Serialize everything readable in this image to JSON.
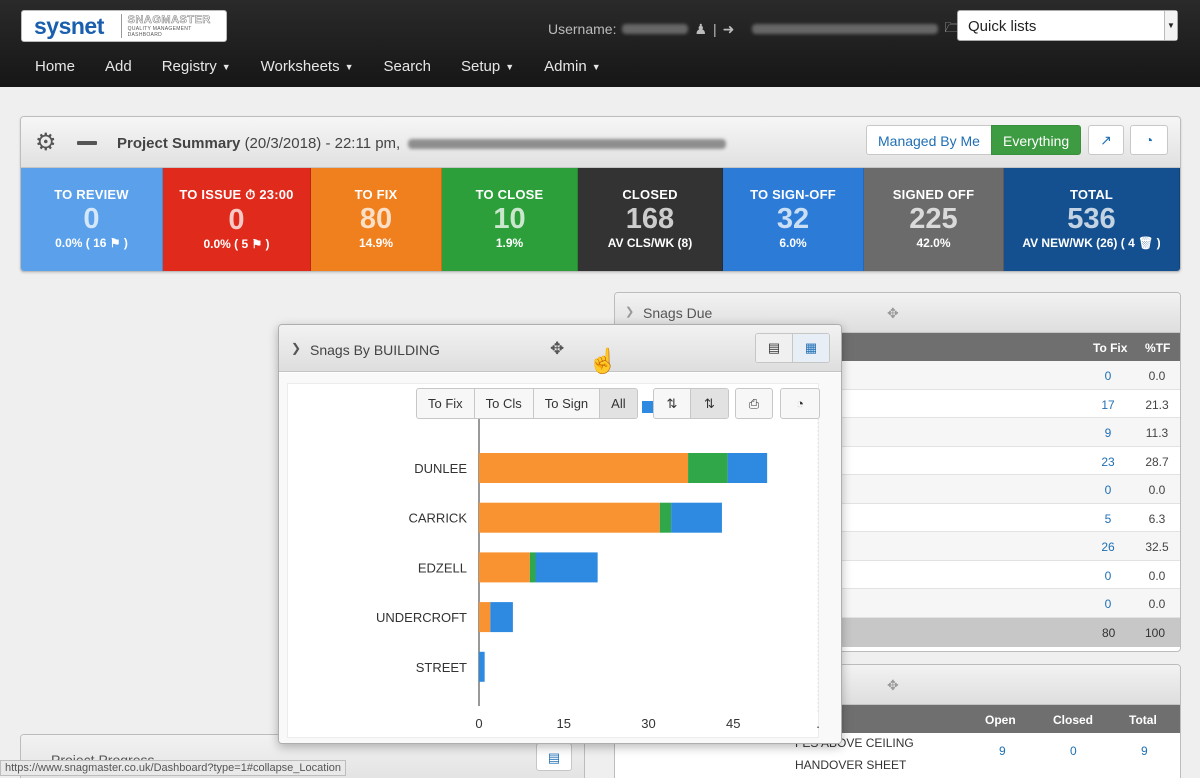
{
  "header": {
    "logo_main": "sysnet",
    "logo_sub": "SNAGMASTER",
    "logo_tagline": "QUALITY MANAGEMENT DASHBOARD",
    "username_label": "Username:",
    "separator": "|",
    "quick_lists": "Quick lists"
  },
  "nav": [
    {
      "label": "Home",
      "dropdown": false
    },
    {
      "label": "Add",
      "dropdown": false
    },
    {
      "label": "Registry",
      "dropdown": true
    },
    {
      "label": "Worksheets",
      "dropdown": true
    },
    {
      "label": "Search",
      "dropdown": false
    },
    {
      "label": "Setup",
      "dropdown": true
    },
    {
      "label": "Admin",
      "dropdown": true
    }
  ],
  "summary": {
    "title": "Project Summary",
    "date": "(20/3/2018) - 22:11 pm,",
    "btn_managed": "Managed By Me",
    "btn_everything": "Everything",
    "tiles": [
      {
        "label": "TO REVIEW",
        "value": "0",
        "sub": "0.0% ( 16 ⚑ )",
        "color": "#5aa0ea"
      },
      {
        "label": "TO ISSUE ⏱ 23:00",
        "value": "0",
        "sub": "0.0% ( 5 ⚑ )",
        "color": "#e02a1c"
      },
      {
        "label": "TO FIX",
        "value": "80",
        "sub": "14.9%",
        "color": "#f07f1d"
      },
      {
        "label": "TO CLOSE",
        "value": "10",
        "sub": "1.9%",
        "color": "#2c9f3b"
      },
      {
        "label": "CLOSED",
        "value": "168",
        "sub": "AV CLS/WK (8)",
        "color": "#333333"
      },
      {
        "label": "TO SIGN-OFF",
        "value": "32",
        "sub": "6.0%",
        "color": "#2c7bd6"
      },
      {
        "label": "SIGNED OFF",
        "value": "225",
        "sub": "42.0%",
        "color": "#6b6b6b"
      },
      {
        "label": "TOTAL",
        "value": "536",
        "sub": "AV NEW/WK (26) ( 4 🗑 )",
        "color": "#14508f"
      }
    ]
  },
  "snags_due": {
    "title": "Snags Due",
    "col_to_fix": "To Fix",
    "col_tf": "%TF",
    "rows": [
      {
        "to_fix": "0",
        "tf": "0.0"
      },
      {
        "to_fix": "17",
        "tf": "21.3"
      },
      {
        "to_fix": "9",
        "tf": "11.3"
      },
      {
        "to_fix": "23",
        "tf": "28.7"
      },
      {
        "to_fix": "0",
        "tf": "0.0"
      },
      {
        "to_fix": "5",
        "tf": "6.3"
      },
      {
        "to_fix": "26",
        "tf": "32.5"
      },
      {
        "to_fix": "0",
        "tf": "0.0"
      },
      {
        "to_fix": "0",
        "tf": "0.0"
      }
    ],
    "total_to_fix": "80",
    "total_tf": "100"
  },
  "location_panel": {
    "col_open": "Open",
    "col_closed": "Closed",
    "col_total": "Total",
    "rows": [
      {
        "name": "FES ABOVE CEILING",
        "open": "9",
        "closed": "0",
        "total": "9"
      },
      {
        "name": "HANDOVER SHEET",
        "open": "",
        "closed": "",
        "total": ""
      }
    ]
  },
  "progress_panel": {
    "title": "Project Progress"
  },
  "chart_widget": {
    "title": "Snags By BUILDING",
    "filters": [
      "To Fix",
      "To Cls",
      "To Sign",
      "All"
    ],
    "active_filter": "All"
  },
  "chart_data": {
    "type": "bar",
    "orientation": "horizontal",
    "stacked": true,
    "categories": [
      "DUNLEE",
      "CARRICK",
      "EDZELL",
      "UNDERCROFT",
      "STREET"
    ],
    "series": [
      {
        "name": "To Fix",
        "color": "#f99331",
        "values": [
          37,
          32,
          9,
          2,
          0
        ]
      },
      {
        "name": "To Cls",
        "color": "#30a84a",
        "values": [
          7,
          2,
          1,
          0,
          0
        ]
      },
      {
        "name": "To Sign",
        "color": "#2e8ae0",
        "values": [
          7,
          9,
          11,
          4,
          1
        ]
      }
    ],
    "xticks": [
      "0",
      "15",
      "30",
      "45",
      "."
    ],
    "xlim": [
      0,
      60
    ],
    "legend_position": "top"
  },
  "status_bar": "https://www.snagmaster.co.uk/Dashboard?type=1#collapse_Location",
  "colors": {
    "accent_blue": "#1f6fb5",
    "everything_green": "#3d9b41"
  }
}
